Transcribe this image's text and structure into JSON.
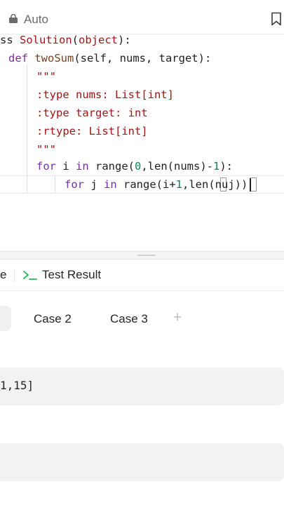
{
  "header": {
    "mode_label": "Auto",
    "lock_icon": "lock-icon",
    "bookmark_icon": "bookmark-icon"
  },
  "editor": {
    "lines": [
      {
        "tokens": [
          [
            "plain",
            "ss "
          ],
          [
            "cls",
            "Solution"
          ],
          [
            "plain",
            "("
          ],
          [
            "cls",
            "object"
          ],
          [
            "plain",
            "):"
          ]
        ]
      },
      {
        "tokens": [
          [
            "kw",
            "def "
          ],
          [
            "fn",
            "twoSum"
          ],
          [
            "plain",
            "(self, nums, target):"
          ]
        ]
      },
      {
        "tokens": [
          [
            "str",
            "\"\"\""
          ]
        ]
      },
      {
        "tokens": [
          [
            "str",
            ":type nums: List[int]"
          ]
        ]
      },
      {
        "tokens": [
          [
            "str",
            ":type target: int"
          ]
        ]
      },
      {
        "tokens": [
          [
            "str",
            ":rtype: List[int]"
          ]
        ]
      },
      {
        "tokens": [
          [
            "str",
            "\"\"\""
          ]
        ]
      },
      {
        "tokens": []
      },
      {
        "tokens": [
          [
            "kw",
            "for "
          ],
          [
            "plain",
            "i "
          ],
          [
            "kw",
            "in "
          ],
          [
            "plain",
            "range("
          ],
          [
            "num",
            "0"
          ],
          [
            "plain",
            ",len(nums)-"
          ],
          [
            "num",
            "1"
          ],
          [
            "plain",
            "):"
          ]
        ]
      },
      {
        "tokens": [
          [
            "kw",
            "for "
          ],
          [
            "plain",
            "j "
          ],
          [
            "kw",
            "in "
          ],
          [
            "plain",
            "range(i+"
          ],
          [
            "num",
            "1"
          ],
          [
            "plain",
            ",len(nuj))"
          ]
        ]
      }
    ]
  },
  "bottom_panel": {
    "tabs": {
      "previous_tab_fragment": "e",
      "test_result_label": "Test Result",
      "terminal_icon": "terminal-icon"
    },
    "cases": [
      "Case 2",
      "Case 3"
    ],
    "add_case_label": "+",
    "input_value": "1,15]"
  },
  "colors": {
    "keyword": "#7a2ea6",
    "class_name": "#a31515",
    "string": "#a31515",
    "number": "#098658",
    "function": "#7a3f1d"
  }
}
